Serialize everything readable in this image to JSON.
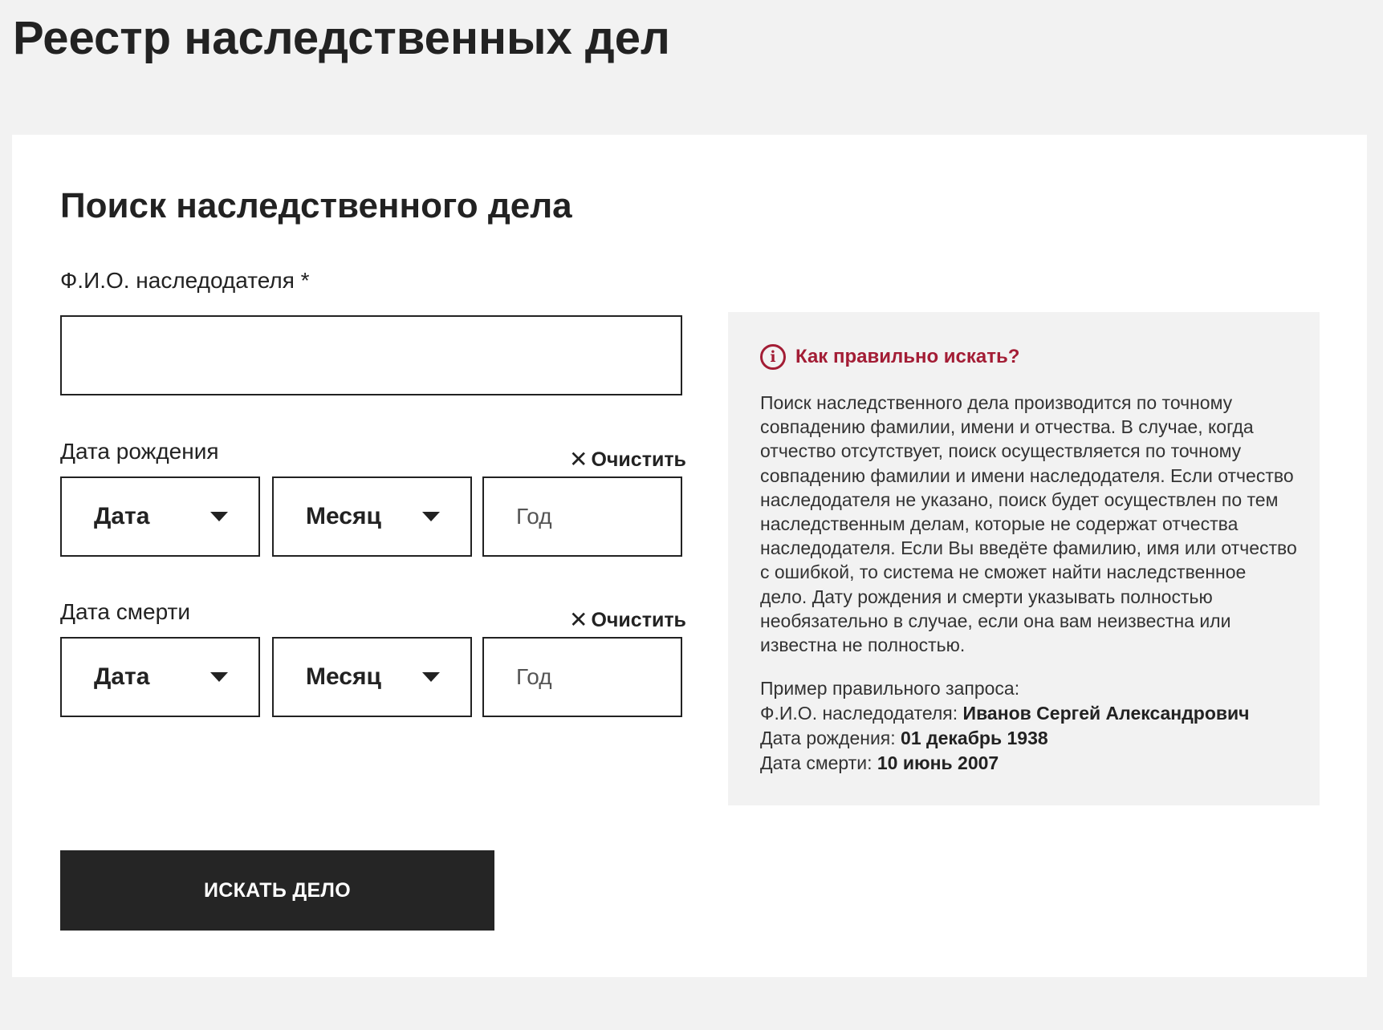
{
  "page": {
    "title": "Реестр наследственных дел"
  },
  "form": {
    "title": "Поиск наследственного дела",
    "fio_label": "Ф.И.О. наследодателя *",
    "fio_value": "",
    "birth": {
      "label": "Дата рождения",
      "clear_label": "Очистить",
      "day_label": "Дата",
      "month_label": "Месяц",
      "year_placeholder": "Год",
      "year_value": ""
    },
    "death": {
      "label": "Дата смерти",
      "clear_label": "Очистить",
      "day_label": "Дата",
      "month_label": "Месяц",
      "year_placeholder": "Год",
      "year_value": ""
    },
    "submit_label": "ИСКАТЬ ДЕЛО"
  },
  "help": {
    "title": "Как правильно искать?",
    "text": "Поиск наследственного дела производится по точному совпадению фамилии, имени и отчества. В случае, когда отчество отсутствует, поиск осуществляется по точному совпадению фамилии и имени наследодателя. Если отчество наследодателя не указано, поиск будет осуществлен по тем наследственным делам, которые не содержат отчества наследодателя. Если Вы введёте фамилию, имя или отчество с ошибкой, то система не сможет найти наследственное дело. Дату рождения и смерти указывать полностью необязательно в случае, если она вам неизвестна или известна не полностью.",
    "example_heading": "Пример правильного запроса:",
    "example_fio_label": "Ф.И.О. наследодателя:",
    "example_fio_value": "Иванов Сергей Александрович",
    "example_birth_label": "Дата рождения:",
    "example_birth_value": "01 декабрь 1938",
    "example_death_label": "Дата смерти:",
    "example_death_value": "10 июнь 2007"
  },
  "colors": {
    "page_background": "#f2f2f2",
    "card_background": "#ffffff",
    "text": "#222222",
    "accent": "#a31d35",
    "button_background": "#252525",
    "button_text": "#ffffff"
  },
  "icons": {
    "info": "info-circle-icon",
    "clear": "close-icon",
    "dropdown": "chevron-down-icon"
  }
}
